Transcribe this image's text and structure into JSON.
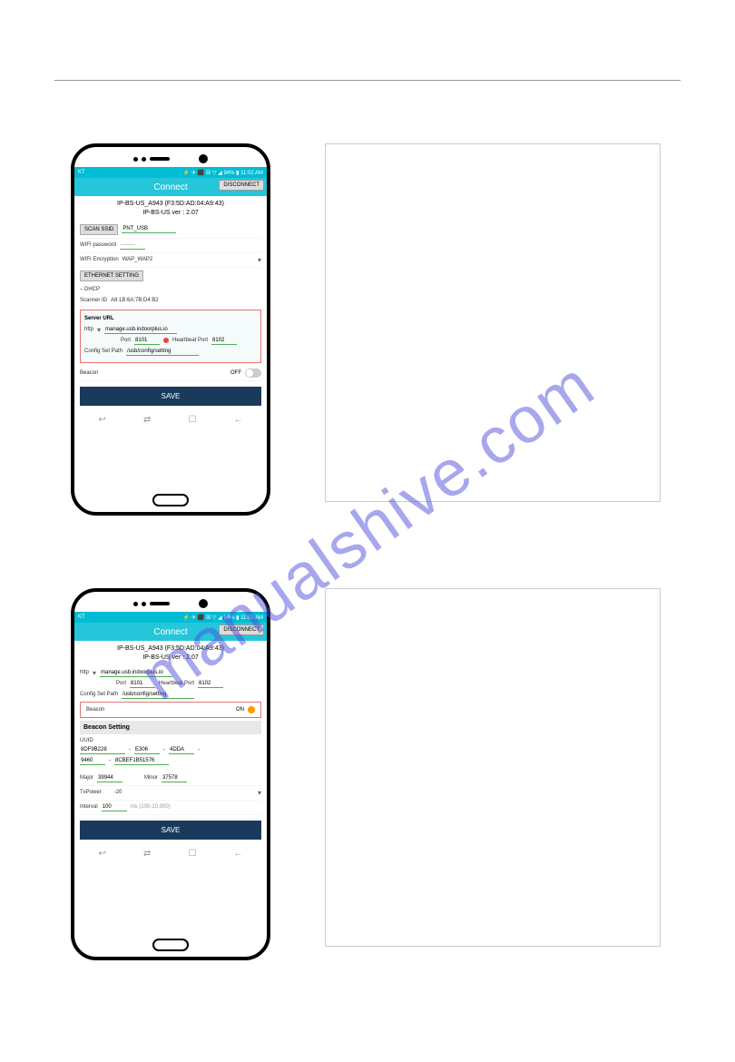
{
  "watermark": "manualshive.com",
  "status": {
    "carrier": "KT",
    "icons": "⚡ ✈ ⬛ ☒ ▽ ◢ 94% ▮ 11:02 AM"
  },
  "app": {
    "title": "Connect",
    "disconnect": "DISCONNECT"
  },
  "device": {
    "line1": "IP-BS-US_A943 (F3:5D:AD:04:A9:43)",
    "line2": "IP-BS-US  ver : 2.07"
  },
  "screen1": {
    "scan_ssid_btn": "SCAN SSID",
    "ssid": "PNT_USB",
    "wifi_pw_label": "WIFI password",
    "wifi_pw": "········",
    "wifi_enc_label": "WIFI Encryption",
    "wifi_enc": "WAP_WAP2",
    "ethernet_btn": "ETHERNET SETTING",
    "dhcp": "– DHCP",
    "scanner_label": "Scanner ID",
    "scanner_id": "A8:1B:6A:7B:D4:B2",
    "server_url_label": "Server URL",
    "protocol": "http",
    "server": "manage.usb.indoorplus.io",
    "port_label": "Port",
    "port": "8101",
    "hb_label": "Heartbeat Port",
    "hb_port": "8102",
    "config_label": "Config Set Path",
    "config_path": "/usb/config/setting",
    "beacon_label": "Beacon",
    "beacon_state": "OFF",
    "save": "SAVE"
  },
  "screen2": {
    "protocol": "http",
    "server": "manage.usb.indoorplus.io",
    "port_label": "Port",
    "port": "8101",
    "hb_label": "Heartbeat Port",
    "hb_port": "8102",
    "config_label": "Config Set Path",
    "config_path": "/usb/config/setting",
    "beacon_label": "Beacon",
    "beacon_state": "ON",
    "beacon_setting": "Beacon Setting",
    "uuid_label": "UUID",
    "uuid1": "8DF9B228",
    "uuid2": "E306",
    "uuid3": "4DDA",
    "uuid4": "9460",
    "uuid5": "8CBEF1B51576",
    "major_label": "Major",
    "major": "39944",
    "minor_label": "Minor",
    "minor": "37578",
    "txpower_label": "TxPower",
    "txpower": "-20",
    "interval_label": "Interval",
    "interval": "100",
    "interval_hint": "ms (100-10,000)",
    "save": "SAVE"
  },
  "nav": {
    "back": "↩",
    "recent": "⇄",
    "home": "☐",
    "return": "←"
  }
}
